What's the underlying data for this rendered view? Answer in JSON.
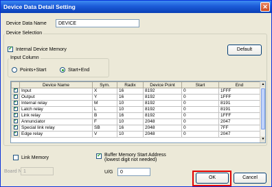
{
  "window": {
    "title": "Device Data Detail Setting",
    "close_glyph": "✕"
  },
  "data_name": {
    "label": "Device Data Name",
    "value": "DEVICE"
  },
  "device_selection": {
    "label": "Device Selection",
    "internal_memory_label": "Internal Device Memory",
    "internal_memory_checked": true,
    "default_button": "Default",
    "input_column": {
      "label": "Input Column",
      "options": [
        "Points+Start",
        "Start+End"
      ],
      "selected": "Start+End"
    }
  },
  "table": {
    "columns": [
      "",
      "Device Name",
      "Sym.",
      "Radix",
      "Device Point",
      "Start",
      "End"
    ],
    "rows": [
      {
        "checked": true,
        "name": "Input",
        "sym": "X",
        "radix": "16",
        "point": "8192",
        "start": "0",
        "end": "1FFF"
      },
      {
        "checked": true,
        "name": "Output",
        "sym": "Y",
        "radix": "16",
        "point": "8192",
        "start": "0",
        "end": "1FFF"
      },
      {
        "checked": true,
        "name": "Internal relay",
        "sym": "M",
        "radix": "10",
        "point": "8192",
        "start": "0",
        "end": "8191"
      },
      {
        "checked": true,
        "name": "Latch relay",
        "sym": "L",
        "radix": "10",
        "point": "8192",
        "start": "0",
        "end": "8191"
      },
      {
        "checked": true,
        "name": "Link relay",
        "sym": "B",
        "radix": "16",
        "point": "8192",
        "start": "0",
        "end": "1FFF"
      },
      {
        "checked": true,
        "name": "Annunciator",
        "sym": "F",
        "radix": "10",
        "point": "2048",
        "start": "0",
        "end": "2047"
      },
      {
        "checked": true,
        "name": "Special link relay",
        "sym": "SB",
        "radix": "16",
        "point": "2048",
        "start": "0",
        "end": "7FF"
      },
      {
        "checked": true,
        "name": "Edge relay",
        "sym": "V",
        "radix": "10",
        "point": "2048",
        "start": "0",
        "end": "2047"
      }
    ]
  },
  "link_memory": {
    "label": "Link Memory",
    "checked": false,
    "board_no_label": "Board No.",
    "board_no_value": "1"
  },
  "buffer_memory": {
    "label_line1": "Buffer Memory Start Address",
    "label_line2": "(lowest digit not needed)",
    "checked": true,
    "ug_label": "U/G",
    "ug_value": "0"
  },
  "buttons": {
    "ok": "OK",
    "cancel": "Cancel"
  },
  "colors": {
    "highlight": "#e00000",
    "titlebar": "#1c5bd8"
  }
}
